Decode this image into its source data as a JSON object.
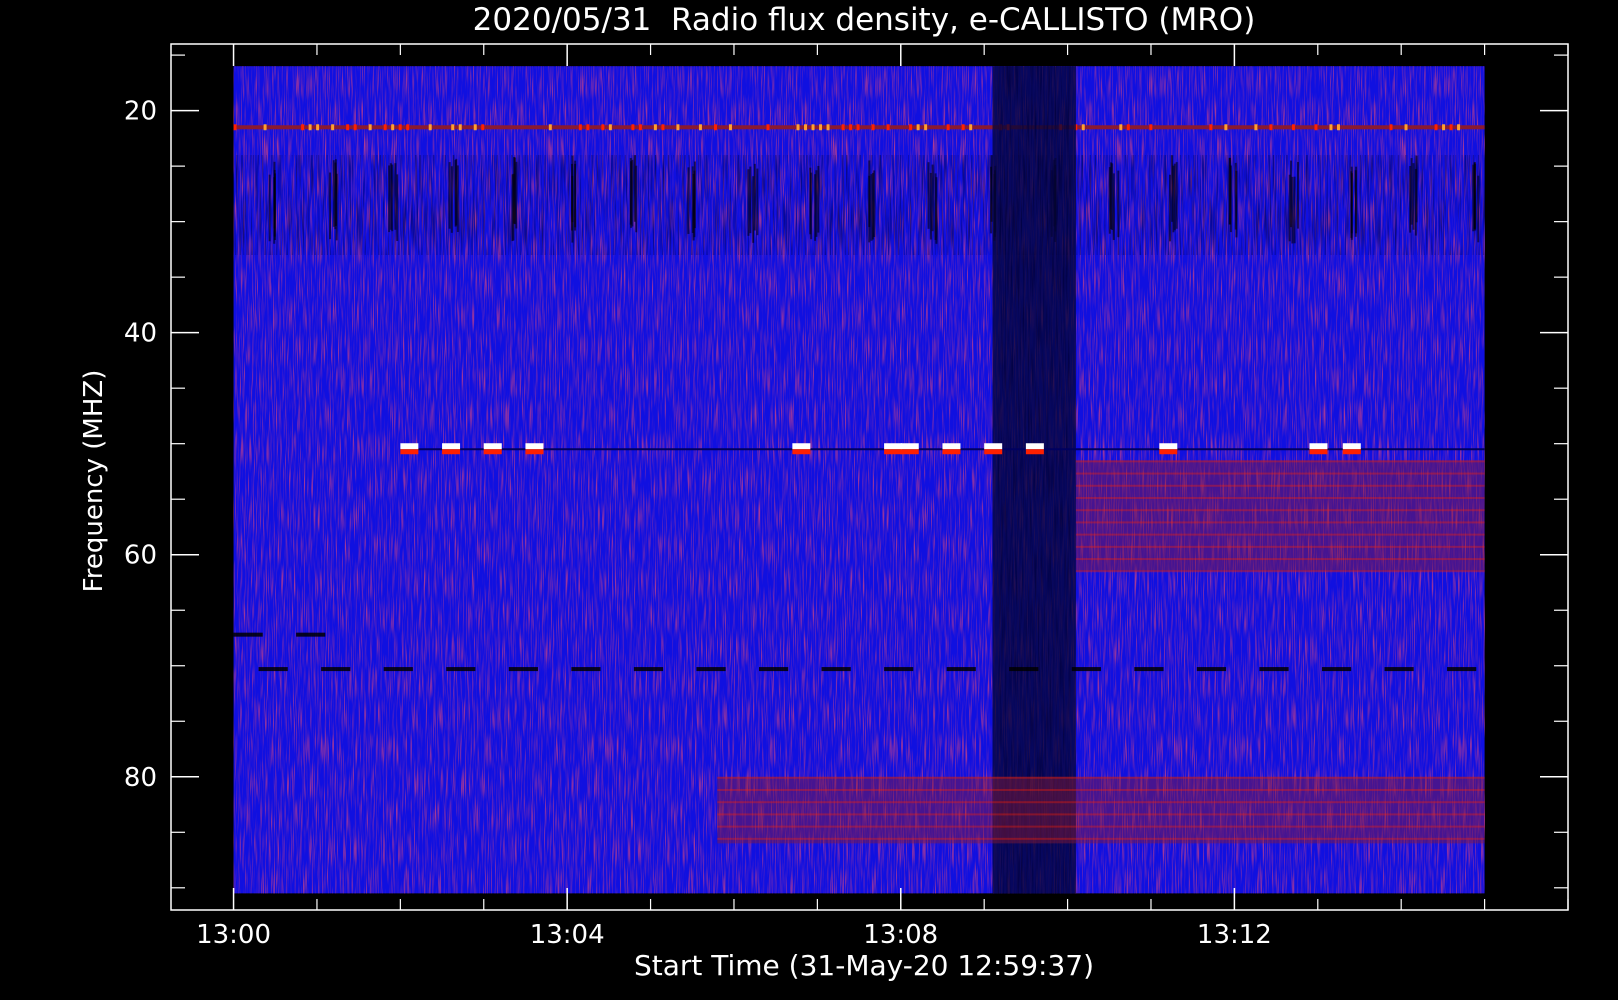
{
  "chart_data": {
    "type": "heatmap",
    "title": "2020/05/31  Radio flux density, e-CALLISTO (MRO)",
    "xlabel": "Start Time (31-May-20 12:59:37)",
    "ylabel": "Frequency (MHZ)",
    "x_major_ticks": [
      "13:00",
      "13:04",
      "13:08",
      "13:12"
    ],
    "x_major_minutes": [
      0,
      4,
      8,
      12
    ],
    "xlim_minutes_after_1300": [
      -0.75,
      16
    ],
    "y_major_ticks": [
      "20",
      "40",
      "60",
      "80"
    ],
    "y_major_values": [
      20,
      40,
      60,
      80
    ],
    "ylim": [
      14,
      92
    ],
    "y_inverted": true,
    "data_extent": {
      "time_minutes_after_1300": [
        0,
        15
      ],
      "frequency_mhz": [
        16,
        90.5
      ]
    },
    "colormap": [
      "#000000",
      "#0000ff",
      "#8a1a30",
      "#ff2000",
      "#ffffff"
    ],
    "background_color": "#1010e0",
    "features": [
      {
        "kind": "narrowband-interference",
        "frequency_mhz": 21.5,
        "time_minutes": [
          0,
          15
        ],
        "intensity": "high"
      },
      {
        "kind": "broadband-dropout",
        "time_minutes": [
          9.1,
          10.1
        ],
        "intensity": "low"
      },
      {
        "kind": "elevated-band",
        "frequency_mhz": [
          51.5,
          61.5
        ],
        "time_minutes": [
          10.1,
          15
        ],
        "intensity": "medium"
      },
      {
        "kind": "narrowband-interference",
        "frequency_mhz": 50.5,
        "time_minutes": [
          2.0,
          15
        ],
        "intensity": "saturated"
      },
      {
        "kind": "narrowband-interference",
        "frequency_mhz": 70.3,
        "time_minutes": [
          0.3,
          15
        ],
        "intensity": "low"
      },
      {
        "kind": "elevated-band",
        "frequency_mhz": [
          80,
          86
        ],
        "time_minutes": [
          5.8,
          15
        ],
        "intensity": "medium"
      },
      {
        "kind": "narrowband-interference",
        "frequency_mhz": 67.2,
        "time_minutes": [
          0,
          1
        ],
        "intensity": "low"
      }
    ]
  }
}
